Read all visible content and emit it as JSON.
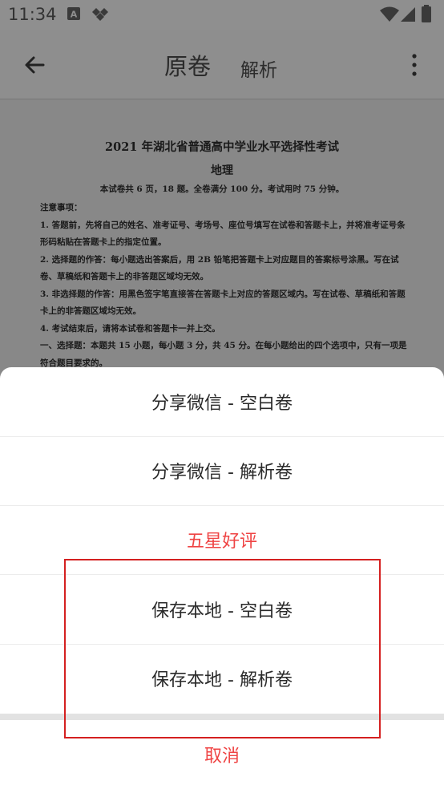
{
  "status_bar": {
    "time": "11:34",
    "icons": [
      "a-square-icon",
      "diamond-icon",
      "wifi-icon",
      "signal-icon",
      "battery-icon"
    ]
  },
  "app_bar": {
    "tab_original": "原卷",
    "tab_analysis": "解析"
  },
  "document": {
    "title": "2021 年湖北省普通高中学业水平选择性考试",
    "subject": "地理",
    "intro": "本试卷共 6 页，18 题。全卷满分 100 分。考试用时 75 分钟。",
    "lines": [
      "注意事项：",
      "1. 答题前，先将自己的姓名、准考证号、考场号、座位号填写在试卷和答题卡上，并将准考证号条形码粘贴在答题卡上的指定位置。",
      "2. 选择题的作答：每小题选出答案后，用 2B 铅笔把答题卡上对应题目的答案标号涂黑。写在试卷、草稿纸和答题卡上的非答题区域均无效。",
      "3. 非选择题的作答：用黑色签字笔直接答在答题卡上对应的答题区域内。写在试卷、草稿纸和答题卡上的非答题区域均无效。",
      "4. 考试结束后，请将本试卷和答题卡一并上交。",
      "一、选择题：本题共 15 小题，每小题 3 分，共 45 分。在每小题给出的四个选项中，只有一项是符合题目要求的。"
    ]
  },
  "sheet": {
    "items": [
      {
        "label": "分享微信 - 空白卷"
      },
      {
        "label": "分享微信 - 解析卷"
      },
      {
        "label": "五星好评"
      },
      {
        "label": "保存本地 - 空白卷"
      },
      {
        "label": "保存本地 - 解析卷"
      }
    ],
    "cancel": "取消"
  },
  "colors": {
    "accent_red": "#ef4444",
    "highlight_border": "#d42020"
  }
}
